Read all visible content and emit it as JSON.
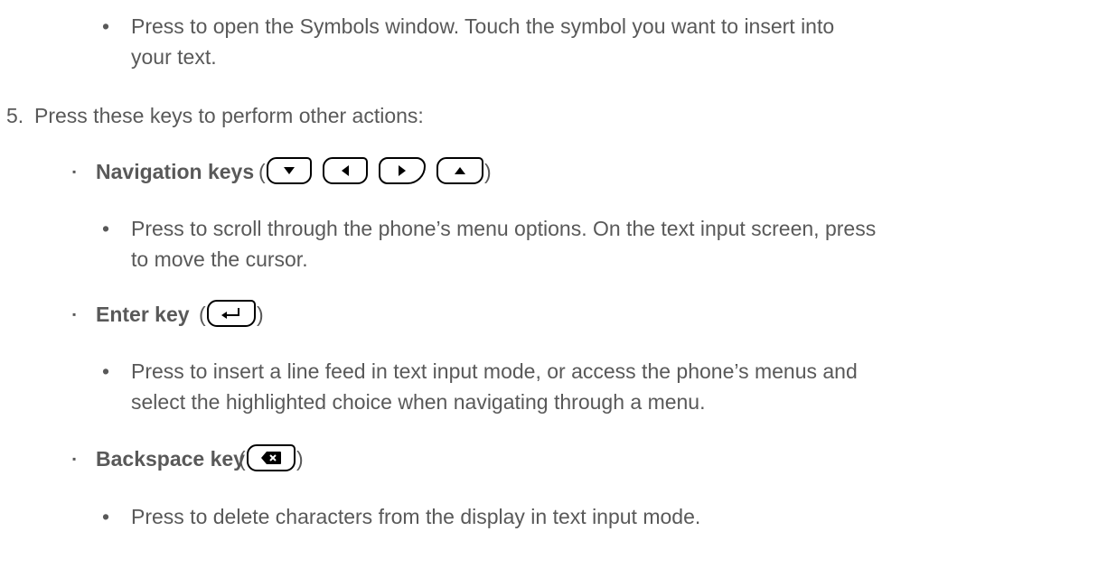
{
  "intro_bullet": {
    "marker": "•",
    "text_line1": "Press to open the Symbols window. Touch the symbol you want to insert into",
    "text_line2": "your text."
  },
  "step5": {
    "number": "5.",
    "text": "Press these keys to perform other actions:"
  },
  "navigation_keys": {
    "marker": "▪",
    "label": "Navigation keys",
    "paren_open": "(",
    "paren_close": ")",
    "icons": [
      "down-arrow-key-icon",
      "left-arrow-key-icon",
      "right-arrow-key-icon",
      "up-arrow-key-icon"
    ],
    "desc_marker": "•",
    "desc_line1": "Press to scroll through the phone’s menu options. On the text input screen, press",
    "desc_line2": "to move the cursor."
  },
  "enter_key": {
    "marker": "▪",
    "label": "Enter key",
    "paren_open": "(",
    "paren_close": ")",
    "icon": "enter-key-icon",
    "desc_marker": "•",
    "desc_line1": "Press to insert a line feed in text input mode, or access the phone’s menus and",
    "desc_line2": "select the highlighted choice when navigating through a menu."
  },
  "backspace_key": {
    "marker": "▪",
    "label": "Backspace key",
    "paren_open": "(",
    "paren_close": ")",
    "icon": "backspace-key-icon",
    "desc_marker": "•",
    "desc_line1": "Press to delete characters from the display in text input mode."
  }
}
